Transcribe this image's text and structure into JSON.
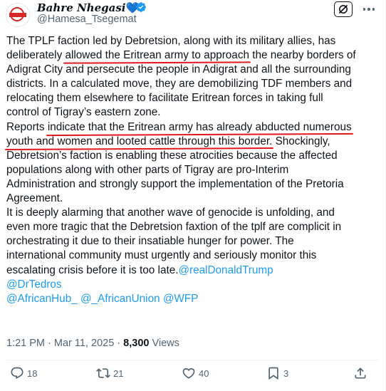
{
  "author": {
    "display_name": "Bahre Nhegasi",
    "emoji": "💙",
    "handle": "@Hamesa_Tsegemat"
  },
  "icons": {
    "verified": "verified-badge-icon",
    "grok": "grok-icon",
    "more": "more-icon",
    "reply": "reply-icon",
    "retweet": "retweet-icon",
    "like": "like-icon",
    "bookmark": "bookmark-icon",
    "share": "share-icon"
  },
  "colors": {
    "text": "#0f1419",
    "secondary": "#536471",
    "link": "#1d9bf0",
    "underline": "#e3171e"
  },
  "body_lines": [
    [
      {
        "t": "The TPLF faction led by Debretsion, along with its military allies, has"
      }
    ],
    [
      {
        "t": "deliberately "
      },
      {
        "t": "allowed the Eritrean army to approach",
        "u": true
      },
      {
        "t": " the nearby borders of"
      }
    ],
    [
      {
        "t": "Adigrat City and persecute the people in Adigrat and all the surrounding"
      }
    ],
    [
      {
        "t": "districts. In a calculated move, they are demobilizing TDF members and"
      }
    ],
    [
      {
        "t": "relocating them elsewhere to facilitate Eritrean forces in taking full"
      }
    ],
    [
      {
        "t": "control of Tigray’s eastern zone."
      }
    ],
    [
      {
        "t": "Reports "
      },
      {
        "t": "indicate that the Eritrean army has already abducted numerous",
        "u": true
      }
    ],
    [
      {
        "t": "youth and women and looted cattle through this border.",
        "u": true
      },
      {
        "t": " Shockingly,"
      }
    ],
    [
      {
        "t": "Debretsion’s faction is enabling these atrocities because the affected"
      }
    ],
    [
      {
        "t": "populations along with other parts of Tigray are pro-Interim"
      }
    ],
    [
      {
        "t": "Administration and strongly support the implementation of the Pretoria"
      }
    ],
    [
      {
        "t": "Agreement."
      }
    ],
    [
      {
        "t": "It is deeply alarming that another wave of genocide is unfolding, and"
      }
    ],
    [
      {
        "t": "even more tragic that the Debretsion faxtion of the tplf are complicit in"
      }
    ],
    [
      {
        "t": "orchestrating it due to their insatiable hunger for power. The"
      }
    ],
    [
      {
        "t": "international community must urgently and seriously monitor this"
      }
    ],
    [
      {
        "t": "escalating crisis before it is too late."
      },
      {
        "t": "@realDonaldTrump",
        "m": true
      }
    ],
    [
      {
        "t": "@DrTedros",
        "m": true
      }
    ],
    [
      {
        "t": "@AfricanHub_",
        "m": true
      },
      {
        "t": " "
      },
      {
        "t": "@_AfricanUnion",
        "m": true
      },
      {
        "t": " "
      },
      {
        "t": "@WFP",
        "m": true
      }
    ]
  ],
  "meta": {
    "time": "1:21 PM",
    "separator": " · ",
    "date": "Mar 11, 2025",
    "views_count": "8,300",
    "views_label": " Views"
  },
  "actions": {
    "replies": "18",
    "reposts": "21",
    "likes": "40",
    "bookmarks": "3"
  }
}
